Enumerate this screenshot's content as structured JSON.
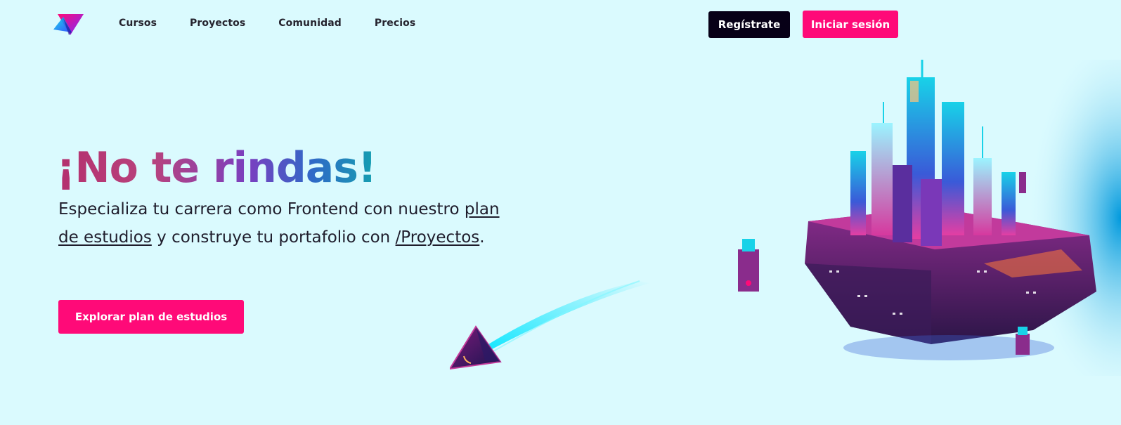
{
  "nav": {
    "logo_icon": "platzi-style-triangle-logo-icon",
    "links": [
      "Cursos",
      "Proyectos",
      "Comunidad",
      "Precios"
    ],
    "register_label": "Regístrate",
    "login_label": "Iniciar sesión"
  },
  "hero": {
    "title": "¡No te rindas!",
    "text_1": "Especializa tu carrera como Frontend con nuestro ",
    "link_1": "plan de estudios",
    "text_2": " y construye tu portafolio con ",
    "link_2": "/Proyectos",
    "text_3": ".",
    "cta_label": "Explorar plan de estudios"
  },
  "art": {
    "arrow_icon": "flying-triangle-ship-icon",
    "island_icon": "floating-futuristic-city-island"
  },
  "colors": {
    "background": "#dafafe",
    "accent_pink": "#ff0a78",
    "dark": "#070017"
  }
}
